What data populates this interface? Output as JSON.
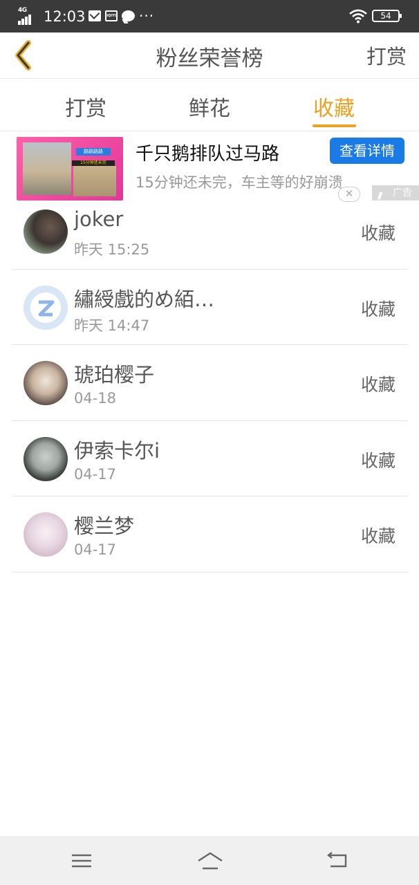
{
  "status_bar": {
    "network": "4G",
    "time": "12:03",
    "dots": "···",
    "battery": "54",
    "icons": [
      "signal-icon",
      "mail-icon",
      "iqiyi-icon",
      "chat-bubble-icon",
      "wifi-icon",
      "battery-icon"
    ],
    "iqiyi_badge": "iQIYI"
  },
  "header": {
    "title": "粉丝荣誉榜",
    "right_action": "打赏",
    "back_icon": "chevron-left-icon"
  },
  "tabs": [
    {
      "label": "打赏",
      "active": false
    },
    {
      "label": "鲜花",
      "active": false
    },
    {
      "label": "收藏",
      "active": true
    }
  ],
  "accent_color": "#f0a020",
  "ad": {
    "title": "千只鹅排队过马路",
    "subtitle": "15分钟还未完，车主等的好崩溃",
    "cta": "查看详情",
    "label": "广告",
    "close": "✕",
    "thumb_tag": "路路路路",
    "thumb_caption": "15分钟还未完",
    "cta_color": "#1b7be6"
  },
  "list": [
    {
      "name": "joker",
      "time": "昨天 15:25",
      "action": "收藏"
    },
    {
      "name": "繡綬戲的め絔…",
      "time": "昨天 14:47",
      "action": "收藏"
    },
    {
      "name": "琥珀樱子",
      "time": "04-18",
      "action": "收藏"
    },
    {
      "name": "伊索卡尔i",
      "time": "04-17",
      "action": "收藏"
    },
    {
      "name": "樱兰梦",
      "time": "04-17",
      "action": "收藏"
    }
  ],
  "nav": [
    "menu-icon",
    "home-icon",
    "back-icon"
  ]
}
